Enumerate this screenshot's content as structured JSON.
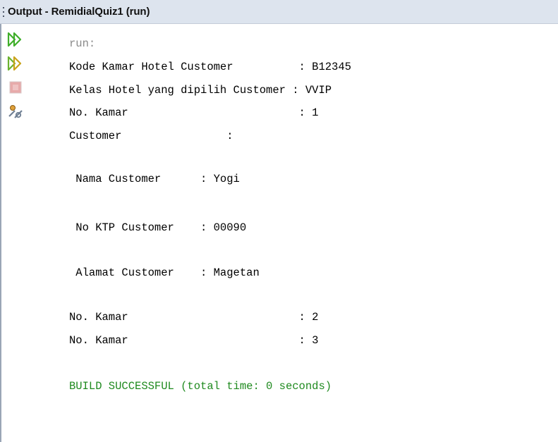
{
  "window": {
    "title": "Output - RemidialQuiz1 (run)"
  },
  "toolbar": {
    "buttons": [
      {
        "name": "rerun",
        "icon": "rerun-icon"
      },
      {
        "name": "rerun-with-options",
        "icon": "rerun-icon"
      },
      {
        "name": "stop",
        "icon": "stop-icon"
      },
      {
        "name": "settings",
        "icon": "settings-icon"
      }
    ]
  },
  "output": {
    "lines": [
      "run:",
      "Kode Kamar Hotel Customer          : B12345",
      "Kelas Hotel yang dipilih Customer : VVIP",
      "No. Kamar                          : 1",
      "Customer                :",
      " Nama Customer      : Yogi",
      " No KTP Customer    : 00090",
      " Alamat Customer    : Magetan",
      "No. Kamar                          : 2",
      "No. Kamar                          : 3",
      "BUILD SUCCESSFUL (total time: 0 seconds)"
    ]
  },
  "colors": {
    "titlebar": "#dde4ee",
    "run_text": "#8a8a8a",
    "success_text": "#1f8a1f",
    "stop_icon": "#e7aaaa"
  }
}
